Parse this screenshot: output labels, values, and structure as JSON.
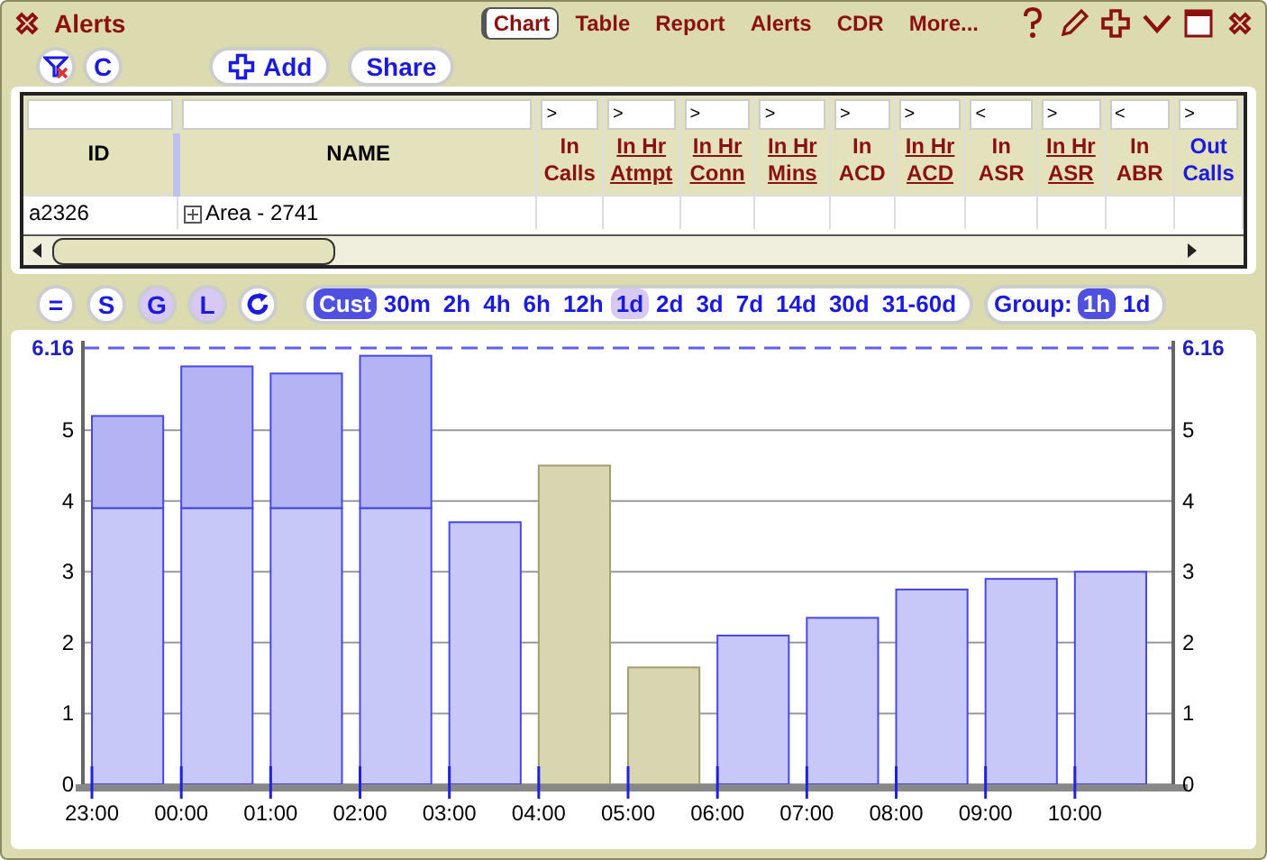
{
  "window": {
    "title": "Alerts"
  },
  "menu": [
    {
      "label": "Chart",
      "selected": true
    },
    {
      "label": "Table",
      "selected": false
    },
    {
      "label": "Report",
      "selected": false
    },
    {
      "label": "Alerts",
      "selected": false
    },
    {
      "label": "CDR",
      "selected": false
    },
    {
      "label": "More...",
      "selected": false
    }
  ],
  "toolbar": {
    "clear_label": "C",
    "add_label": "Add",
    "share_label": "Share"
  },
  "table": {
    "columns": [
      {
        "label": "ID",
        "kind": "plain"
      },
      {
        "label": "NAME",
        "kind": "plain"
      },
      {
        "label": "In Calls",
        "filter": ">",
        "kind": "metric"
      },
      {
        "label": "In Hr Atmpt",
        "filter": ">",
        "kind": "link"
      },
      {
        "label": "In Hr Conn",
        "filter": ">",
        "kind": "link"
      },
      {
        "label": "In Hr Mins",
        "filter": ">",
        "kind": "link"
      },
      {
        "label": "In ACD",
        "filter": ">",
        "kind": "metric"
      },
      {
        "label": "In Hr ACD",
        "filter": ">",
        "kind": "link"
      },
      {
        "label": "In ASR",
        "filter": "<",
        "kind": "metric"
      },
      {
        "label": "In Hr ASR",
        "filter": ">",
        "kind": "link"
      },
      {
        "label": "In ABR",
        "filter": "<",
        "kind": "metric"
      },
      {
        "label": "Out Calls",
        "filter": ">",
        "kind": "other"
      }
    ],
    "rows": [
      {
        "cells": [
          "a2326",
          "Area - 2741",
          "",
          "",
          "",
          "",
          "",
          "",
          "",
          "",
          "",
          ""
        ],
        "expandable": true
      }
    ]
  },
  "chart_toolbar": {
    "modes": [
      {
        "label": "=",
        "selected": false
      },
      {
        "label": "S",
        "selected": false
      },
      {
        "label": "G",
        "selected": true
      },
      {
        "label": "L",
        "selected": true
      }
    ],
    "ranges": [
      {
        "label": "Cust",
        "selected": true,
        "current": false
      },
      {
        "label": "30m",
        "selected": false,
        "current": false
      },
      {
        "label": "2h",
        "selected": false,
        "current": false
      },
      {
        "label": "4h",
        "selected": false,
        "current": false
      },
      {
        "label": "6h",
        "selected": false,
        "current": false
      },
      {
        "label": "12h",
        "selected": false,
        "current": false
      },
      {
        "label": "1d",
        "selected": false,
        "current": true
      },
      {
        "label": "2d",
        "selected": false,
        "current": false
      },
      {
        "label": "3d",
        "selected": false,
        "current": false
      },
      {
        "label": "7d",
        "selected": false,
        "current": false
      },
      {
        "label": "14d",
        "selected": false,
        "current": false
      },
      {
        "label": "30d",
        "selected": false,
        "current": false
      },
      {
        "label": "31-60d",
        "selected": false,
        "current": false
      }
    ],
    "group_label": "Group:",
    "groups": [
      {
        "label": "1h",
        "selected": true
      },
      {
        "label": "1d",
        "selected": false
      }
    ]
  },
  "chart": {
    "right_axis_labels": [
      "6.16",
      "5",
      "4",
      "3",
      "2",
      "1",
      "0"
    ],
    "chart_data": {
      "type": "bar",
      "stacked": true,
      "grid": true,
      "categories": [
        "23:00",
        "00:00",
        "01:00",
        "02:00",
        "03:00",
        "04:00",
        "05:00",
        "06:00",
        "07:00",
        "08:00",
        "09:00",
        "10:00"
      ],
      "series": [
        {
          "color": "#c8c8f8",
          "values": [
            3.9,
            3.9,
            3.9,
            3.9,
            3.7,
            null,
            null,
            2.1,
            2.35,
            2.75,
            2.9,
            3.0
          ]
        },
        {
          "color": "#b4b4f4",
          "values": [
            1.3,
            2.0,
            1.9,
            2.15,
            null,
            null,
            null,
            null,
            null,
            null,
            null,
            null
          ]
        },
        {
          "color": "#d8d6b0",
          "values": [
            null,
            null,
            null,
            null,
            null,
            4.5,
            1.65,
            null,
            null,
            null,
            null,
            null
          ]
        }
      ],
      "ylim": [
        0,
        6.16
      ],
      "yticks": [
        0,
        1,
        2,
        3,
        4,
        5,
        {
          "value": 6.16,
          "label": "6.16"
        }
      ]
    }
  }
}
